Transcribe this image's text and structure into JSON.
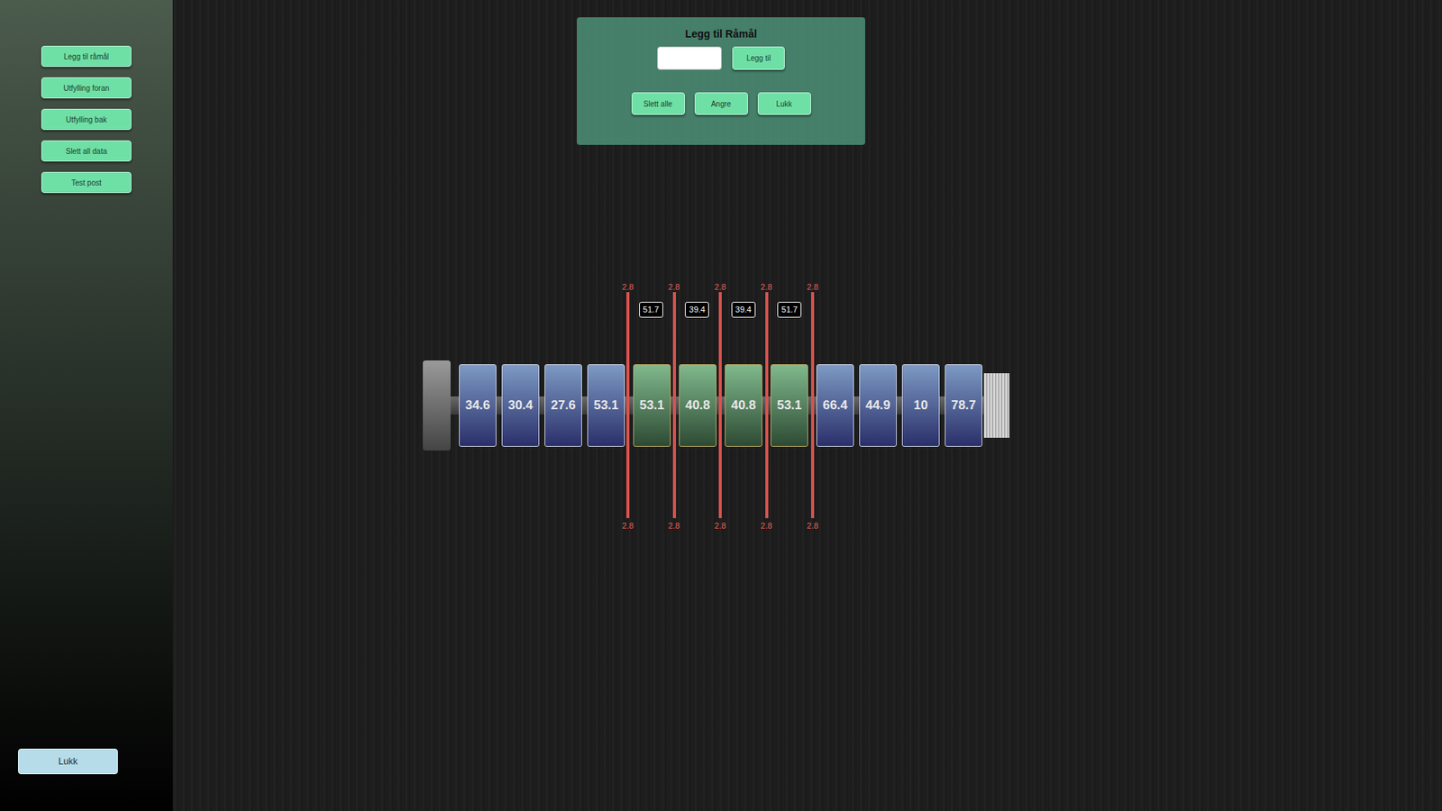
{
  "sidebar": {
    "items": [
      "Legg til råmål",
      "Utfylling foran",
      "Utfylling bak",
      "Slett all data",
      "Test post"
    ],
    "close_button": "Lukk"
  },
  "dialog": {
    "title": "Legg til Råmål",
    "input": {
      "value": ""
    },
    "add_button": "Legg til",
    "buttons": [
      "Slett alle",
      "Angre",
      "Lukk"
    ]
  },
  "shaft": {
    "blocks": [
      {
        "label": "34.6",
        "kind": "raw"
      },
      {
        "label": "30.4",
        "kind": "raw"
      },
      {
        "label": "27.6",
        "kind": "raw"
      },
      {
        "label": "53.1",
        "kind": "raw"
      },
      {
        "label": "53.1",
        "kind": "cut"
      },
      {
        "label": "40.8",
        "kind": "cut"
      },
      {
        "label": "40.8",
        "kind": "cut"
      },
      {
        "label": "53.1",
        "kind": "cut"
      },
      {
        "label": "66.4",
        "kind": "raw"
      },
      {
        "label": "44.9",
        "kind": "raw"
      },
      {
        "label": "10",
        "kind": "raw"
      },
      {
        "label": "78.7",
        "kind": "raw"
      }
    ],
    "cuts": [
      {
        "top": "2.8",
        "bottom": "2.8"
      },
      {
        "top": "2.8",
        "bottom": "2.8"
      },
      {
        "top": "2.8",
        "bottom": "2.8"
      },
      {
        "top": "2.8",
        "bottom": "2.8"
      },
      {
        "top": "2.8",
        "bottom": "2.8"
      }
    ],
    "segments": [
      "51.7",
      "39.4",
      "39.4",
      "51.7"
    ]
  }
}
